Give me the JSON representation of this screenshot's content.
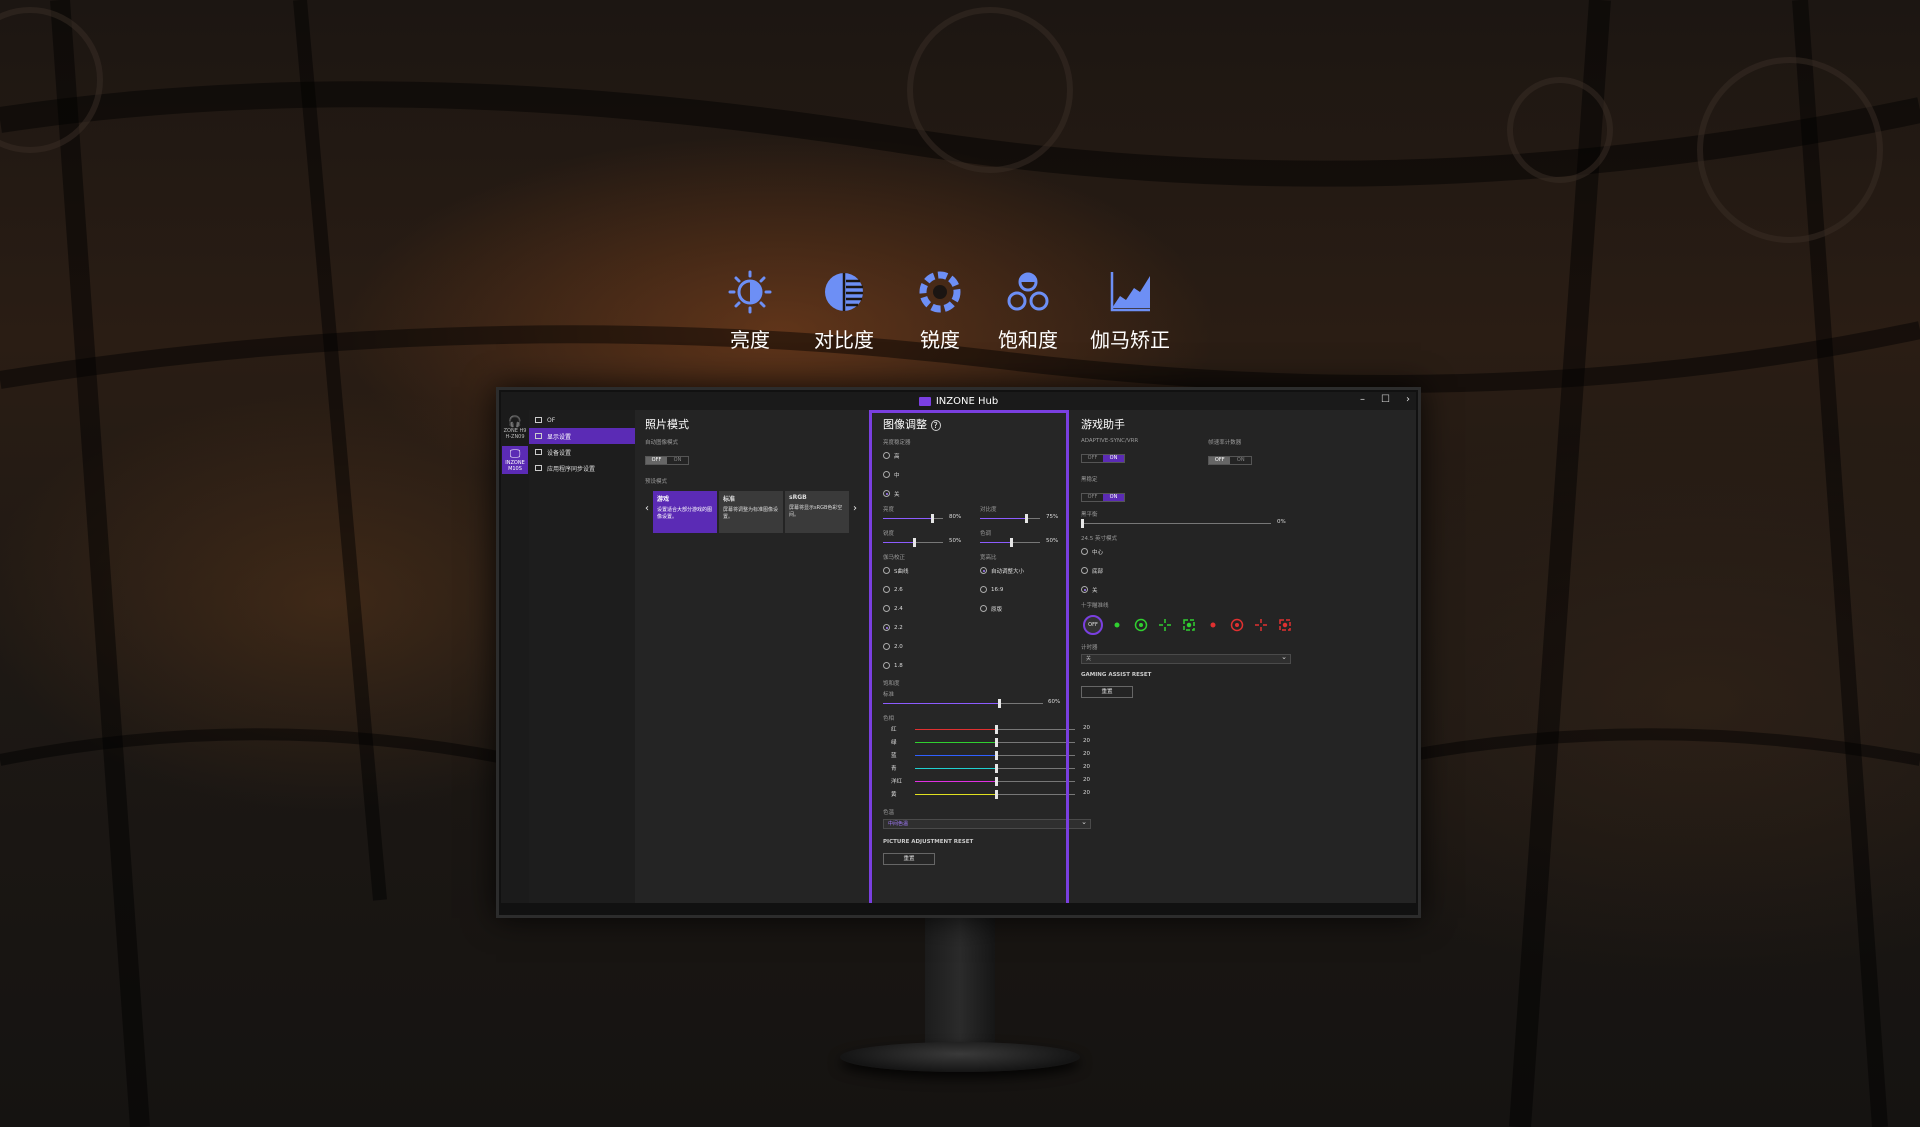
{
  "features": [
    {
      "label": "亮度",
      "icon": "brightness-icon"
    },
    {
      "label": "对比度",
      "icon": "contrast-icon"
    },
    {
      "label": "锐度",
      "icon": "sharpness-icon"
    },
    {
      "label": "饱和度",
      "icon": "saturation-icon"
    },
    {
      "label": "伽马矫正",
      "icon": "gamma-icon"
    }
  ],
  "app": {
    "title": "INZONE Hub",
    "controls": {
      "minimize": "–",
      "maximize": "☐",
      "close": "›"
    }
  },
  "rail": {
    "devices": [
      {
        "label": "ZONE H9",
        "sub": "H-ZN09",
        "glyph": "🎧",
        "active": false
      },
      {
        "label": "INZONE",
        "sub": "M10S",
        "glyph": "🖵",
        "active": true
      }
    ]
  },
  "nav": {
    "items": [
      {
        "label": "OF",
        "active": false
      },
      {
        "label": "显示设置",
        "active": true
      },
      {
        "label": "设备设置",
        "active": false
      },
      {
        "label": "应用程序同步设置",
        "active": false
      }
    ]
  },
  "photo_mode": {
    "title": "照片模式",
    "auto_label": "自动图像模式",
    "auto_toggle": {
      "off": "OFF",
      "on": "ON",
      "value": "OFF"
    },
    "preset_label": "预设模式",
    "prev": "‹",
    "next": "›",
    "modes": [
      {
        "name": "游戏",
        "desc": "设置适合大部分游戏的图像设置。",
        "active": true
      },
      {
        "name": "标准",
        "desc": "屏幕将调整为标准图像设置。",
        "active": false
      },
      {
        "name": "sRGB",
        "desc": "屏幕将显示sRGB色彩空间。",
        "active": false
      }
    ]
  },
  "picture": {
    "title": "图像调整",
    "help": "?",
    "black_eq_label": "亮度稳定器",
    "black_eq_options": [
      {
        "label": "高",
        "selected": false
      },
      {
        "label": "中",
        "selected": false
      },
      {
        "label": "关",
        "selected": true
      }
    ],
    "sliders": [
      {
        "label": "亮度",
        "value": 80,
        "value_text": "80%"
      },
      {
        "label": "对比度",
        "value": 75,
        "value_text": "75%"
      },
      {
        "label": "锐度",
        "value": 50,
        "value_text": "50%"
      },
      {
        "label": "色调",
        "value": 50,
        "value_text": "50%"
      }
    ],
    "gamma_label": "伽马校正",
    "gamma_options": [
      {
        "label": "S曲线",
        "selected": false
      },
      {
        "label": "2.6",
        "selected": false
      },
      {
        "label": "2.4",
        "selected": false
      },
      {
        "label": "2.2",
        "selected": true
      },
      {
        "label": "2.0",
        "selected": false
      },
      {
        "label": "1.8",
        "selected": false
      }
    ],
    "aspect_label": "宽高比",
    "aspect_options": [
      {
        "label": "自动调整大小",
        "selected": true
      },
      {
        "label": "16:9",
        "selected": false
      },
      {
        "label": "原版",
        "selected": false
      }
    ],
    "saturation_label": "饱和度",
    "saturation_sub": "标准",
    "saturation": {
      "value": 60,
      "value_text": "60%"
    },
    "hue_label": "色相",
    "hue_channels": [
      {
        "label": "红",
        "color": "#e03030",
        "value": 20,
        "value_text": "20"
      },
      {
        "label": "绿",
        "color": "#30d030",
        "value": 20,
        "value_text": "20"
      },
      {
        "label": "蓝",
        "color": "#3060ff",
        "value": 20,
        "value_text": "20"
      },
      {
        "label": "青",
        "color": "#20d0d0",
        "value": 20,
        "value_text": "20"
      },
      {
        "label": "洋红",
        "color": "#e030e0",
        "value": 20,
        "value_text": "20"
      },
      {
        "label": "黄",
        "color": "#e0e020",
        "value": 20,
        "value_text": "20"
      }
    ],
    "color_temp_label": "色温",
    "color_temp_value": "中间色温",
    "reset_label": "PICTURE ADJUSTMENT RESET",
    "reset_button": "重置"
  },
  "gaming": {
    "title": "游戏助手",
    "vrr_label": "ADAPTIVE-SYNC/VRR",
    "vrr_toggle": {
      "off": "OFF",
      "on": "ON",
      "value": "ON"
    },
    "fps_label": "帧速率计数器",
    "fps_toggle": {
      "off": "OFF",
      "on": "ON",
      "value": "OFF"
    },
    "black_label": "黑稳定",
    "black_toggle": {
      "off": "OFF",
      "on": "ON",
      "value": "ON"
    },
    "black_eq_label": "黑平衡",
    "black_eq": {
      "value": 0,
      "value_text": "0%"
    },
    "mode245_label": "24.5 英寸模式",
    "mode245_options": [
      {
        "label": "中心",
        "selected": false
      },
      {
        "label": "底部",
        "selected": false
      },
      {
        "label": "关",
        "selected": true
      }
    ],
    "crosshair_label": "十字瞄准线",
    "crosshair_off": "OFF",
    "timer_label": "计时器",
    "timer_value": "关",
    "reset_label": "GAMING ASSIST RESET",
    "reset_button": "重置"
  },
  "colors": {
    "accent": "#7a3fe0",
    "active": "#5b2bb5"
  }
}
